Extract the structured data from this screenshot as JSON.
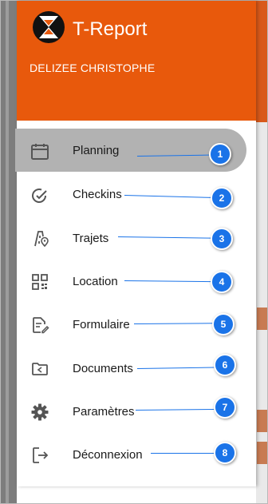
{
  "app": {
    "title": "T-Report",
    "user_name": "DELIZEE CHRISTOPHE",
    "accent_color": "#e8590c"
  },
  "menu": {
    "items": [
      {
        "label": "Planning",
        "icon": "calendar-icon",
        "active": true,
        "badge": "1"
      },
      {
        "label": "Checkins",
        "icon": "check-circle-icon",
        "active": false,
        "badge": "2"
      },
      {
        "label": "Trajets",
        "icon": "route-icon",
        "active": false,
        "badge": "3"
      },
      {
        "label": "Location",
        "icon": "qr-code-icon",
        "active": false,
        "badge": "4"
      },
      {
        "label": "Formulaire",
        "icon": "form-edit-icon",
        "active": false,
        "badge": "5"
      },
      {
        "label": "Documents",
        "icon": "folder-share-icon",
        "active": false,
        "badge": "6"
      },
      {
        "label": "Paramètres",
        "icon": "gear-icon",
        "active": false,
        "badge": "7"
      },
      {
        "label": "Déconnexion",
        "icon": "logout-icon",
        "active": false,
        "badge": "8"
      }
    ]
  },
  "annotation_color": "#1a73e8"
}
